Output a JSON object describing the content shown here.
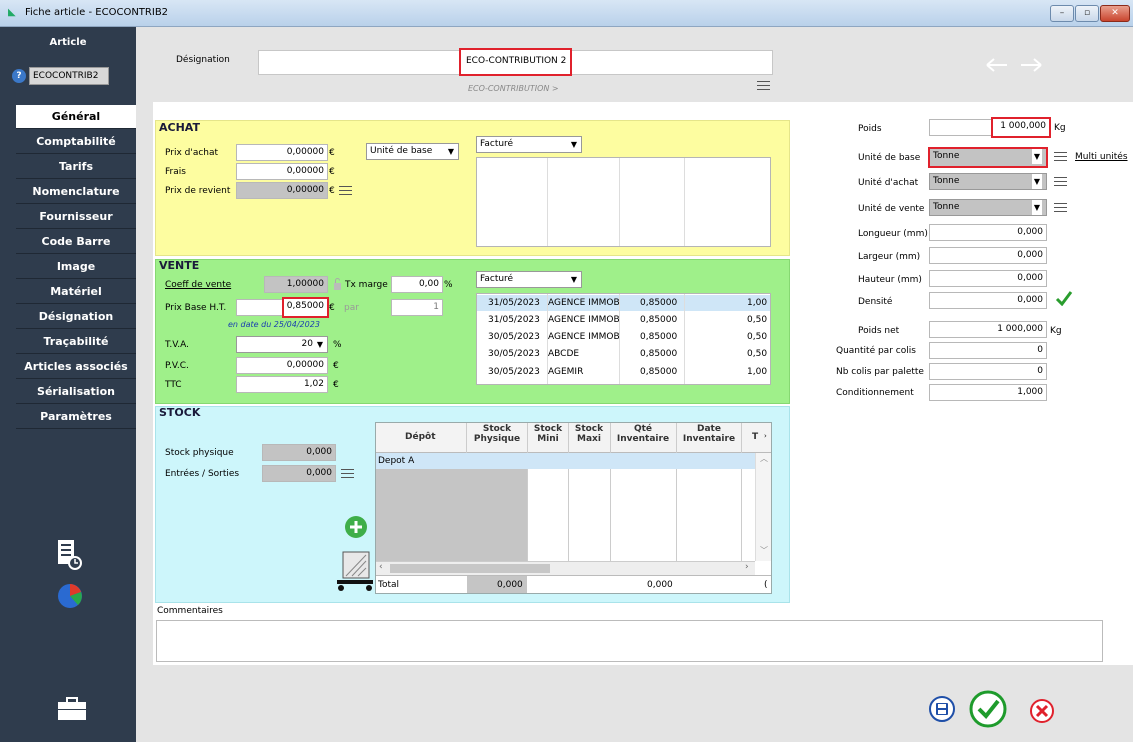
{
  "window": {
    "title": "Fiche article - ECOCONTRIB2"
  },
  "sidebar": {
    "title": "Article",
    "code": "ECOCONTRIB2",
    "tabs": [
      "Général",
      "Comptabilité",
      "Tarifs",
      "Nomenclature",
      "Fournisseur",
      "Code Barre",
      "Image",
      "Matériel",
      "Désignation longue",
      "Traçabilité",
      "Articles associés",
      "Sérialisation",
      "Paramètres"
    ]
  },
  "header": {
    "designation_label": "Désignation",
    "designation_value": "ECO-CONTRIBUTION 2",
    "designation_sub": "ECO-CONTRIBUTION >"
  },
  "achat": {
    "title": "ACHAT",
    "prix_achat_label": "Prix d'achat",
    "prix_achat": "0,00000",
    "frais_label": "Frais",
    "frais": "0,00000",
    "prix_revient_label": "Prix de revient",
    "prix_revient": "0,00000",
    "unit_select": "Unité de base",
    "facture_select": "Facturé",
    "currency": "€"
  },
  "vente": {
    "title": "VENTE",
    "coeff_label": "Coeff de vente",
    "coeff": "1,00000",
    "tx_marge_label": "Tx marge",
    "tx_marge": "0,00",
    "percent": "%",
    "prix_base_label": "Prix Base H.T.",
    "prix_base": "0,85000",
    "par_label": "par",
    "par_value": "1",
    "date_note": "en date du 25/04/2023",
    "tva_label": "T.V.A.",
    "tva": "20",
    "pvc_label": "P.V.C.",
    "pvc": "0,00000",
    "ttc_label": "TTC",
    "ttc": "1,02",
    "currency": "€",
    "facture_select": "Facturé",
    "history": [
      {
        "date": "31/05/2023",
        "client": "AGENCE IMMOB",
        "price": "0,85000",
        "qty": "1,00"
      },
      {
        "date": "31/05/2023",
        "client": "AGENCE IMMOB",
        "price": "0,85000",
        "qty": "0,50"
      },
      {
        "date": "30/05/2023",
        "client": "AGENCE IMMOB",
        "price": "0,85000",
        "qty": "0,50"
      },
      {
        "date": "30/05/2023",
        "client": "ABCDE",
        "price": "0,85000",
        "qty": "0,50"
      },
      {
        "date": "30/05/2023",
        "client": "AGEMIR",
        "price": "0,85000",
        "qty": "1,00"
      }
    ]
  },
  "stock": {
    "title": "STOCK",
    "physique_label": "Stock physique",
    "physique": "0,000",
    "entrees_label": "Entrées / Sorties",
    "entrees": "0,000",
    "columns": [
      "Dépôt",
      "Stock Physique",
      "Stock Mini",
      "Stock Maxi",
      "Qté Inventaire",
      "Date Inventaire",
      "T"
    ],
    "rows": [
      [
        "Depot A",
        "",
        "",
        "",
        "",
        "",
        ""
      ]
    ],
    "total_label": "Total",
    "total_physique": "0,000",
    "total_inventaire": "0,000",
    "total_last": "("
  },
  "comments": {
    "label": "Commentaires"
  },
  "right": {
    "poids_label": "Poids",
    "poids": "1 000,000",
    "kg": "Kg",
    "unite_base_label": "Unité de base",
    "unite_base": "Tonne",
    "multi_unites": "Multi unités",
    "unite_achat_label": "Unité d'achat",
    "unite_achat": "Tonne",
    "unite_vente_label": "Unité de vente",
    "unite_vente": "Tonne",
    "longueur_label": "Longueur (mm)",
    "longueur": "0,000",
    "largeur_label": "Largeur (mm)",
    "largeur": "0,000",
    "hauteur_label": "Hauteur (mm)",
    "hauteur": "0,000",
    "densite_label": "Densité",
    "densite": "0,000",
    "poids_net_label": "Poids net",
    "poids_net": "1 000,000",
    "qte_colis_label": "Quantité par colis",
    "qte_colis": "0",
    "nb_colis_label": "Nb colis par palette",
    "nb_colis": "0",
    "conditionnement_label": "Conditionnement",
    "conditionnement": "1,000"
  },
  "colors": {
    "achat_bg": "#fdfda0",
    "vente_bg": "#9ff08a",
    "stock_bg": "#cdf6fb",
    "sidebar_bg": "#2f3c4d",
    "accent_red": "#e0212c"
  }
}
